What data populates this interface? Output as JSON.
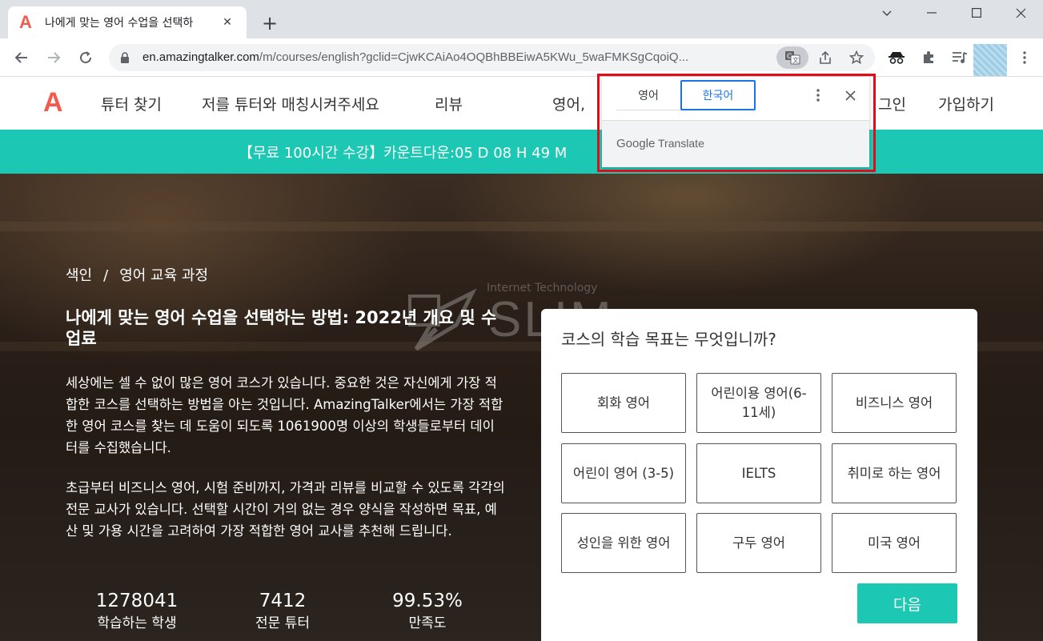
{
  "browser": {
    "tab_title": "나에게 맞는 영어 수업을 선택하",
    "favicon": "A",
    "url_host": "en.amazingtalker.com",
    "url_path": "/m/courses/english?gclid=CjwKCAiAo4OQBhBBEiwA5KWu_5waFMKSgCqoiQ...",
    "new_tab": "+",
    "close_tab": "✕"
  },
  "nav": {
    "logo": "A",
    "find_tutor": "튜터 찾기",
    "match_me": "저를 튜터와 매칭시켜주세요",
    "reviews": "리뷰",
    "language": "영어, ",
    "login": "그인",
    "signup": "가입하기"
  },
  "promo": {
    "text": "【무료 100시간 수강】카운트다운:05 D 08 H 49 M"
  },
  "translate": {
    "source_lang": "영어",
    "target_lang": "한국어",
    "brand_google": "Google",
    "brand_translate": "Translate"
  },
  "hero": {
    "breadcrumb_home": "색인",
    "breadcrumb_sep": "/",
    "breadcrumb_current": "영어 교육 과정",
    "watermark_top": "Internet Technology",
    "watermark_main": "SLIM",
    "title": "나에게 맞는 영어 수업을 선택하는 방법: 2022년 개요 및 수업료",
    "para1": "세상에는 셀 수 없이 많은 영어 코스가 있습니다. 중요한 것은 자신에게 가장 적합한 코스를 선택하는 방법을 아는 것입니다. AmazingTalker에서는 가장 적합한 영어 코스를 찾는 데 도움이 되도록 1061900명 이상의 학생들로부터 데이터를 수집했습니다.",
    "para2": "초급부터 비즈니스 영어, 시험 준비까지, 가격과 리뷰를 비교할 수 있도록 각각의 전문 교사가 있습니다. 선택할 시간이 거의 없는 경우 양식을 작성하면 목표, 예산 및 가용 시간을 고려하여 가장 적합한 영어 교사를 추천해 드립니다.",
    "stats": [
      {
        "value": "1278041",
        "label": "학습하는 학생"
      },
      {
        "value": "7412",
        "label": "전문 튜터"
      },
      {
        "value": "99.53%",
        "label": "만족도"
      }
    ]
  },
  "selector": {
    "question": "코스의 학습 목표는 무엇입니까?",
    "options": [
      "회화 영어",
      "어린이용 영어(6-11세)",
      "비즈니스 영어",
      "어린이 영어 (3-5)",
      "IELTS",
      "취미로 하는 영어",
      "성인을 위한 영어",
      "구두 영어",
      "미국 영어"
    ],
    "next": "다음"
  },
  "colors": {
    "brand_teal": "#1cc8b4",
    "brand_red": "#f25b4d",
    "highlight_red": "#e10c1a",
    "google_blue": "#1a73e8"
  }
}
